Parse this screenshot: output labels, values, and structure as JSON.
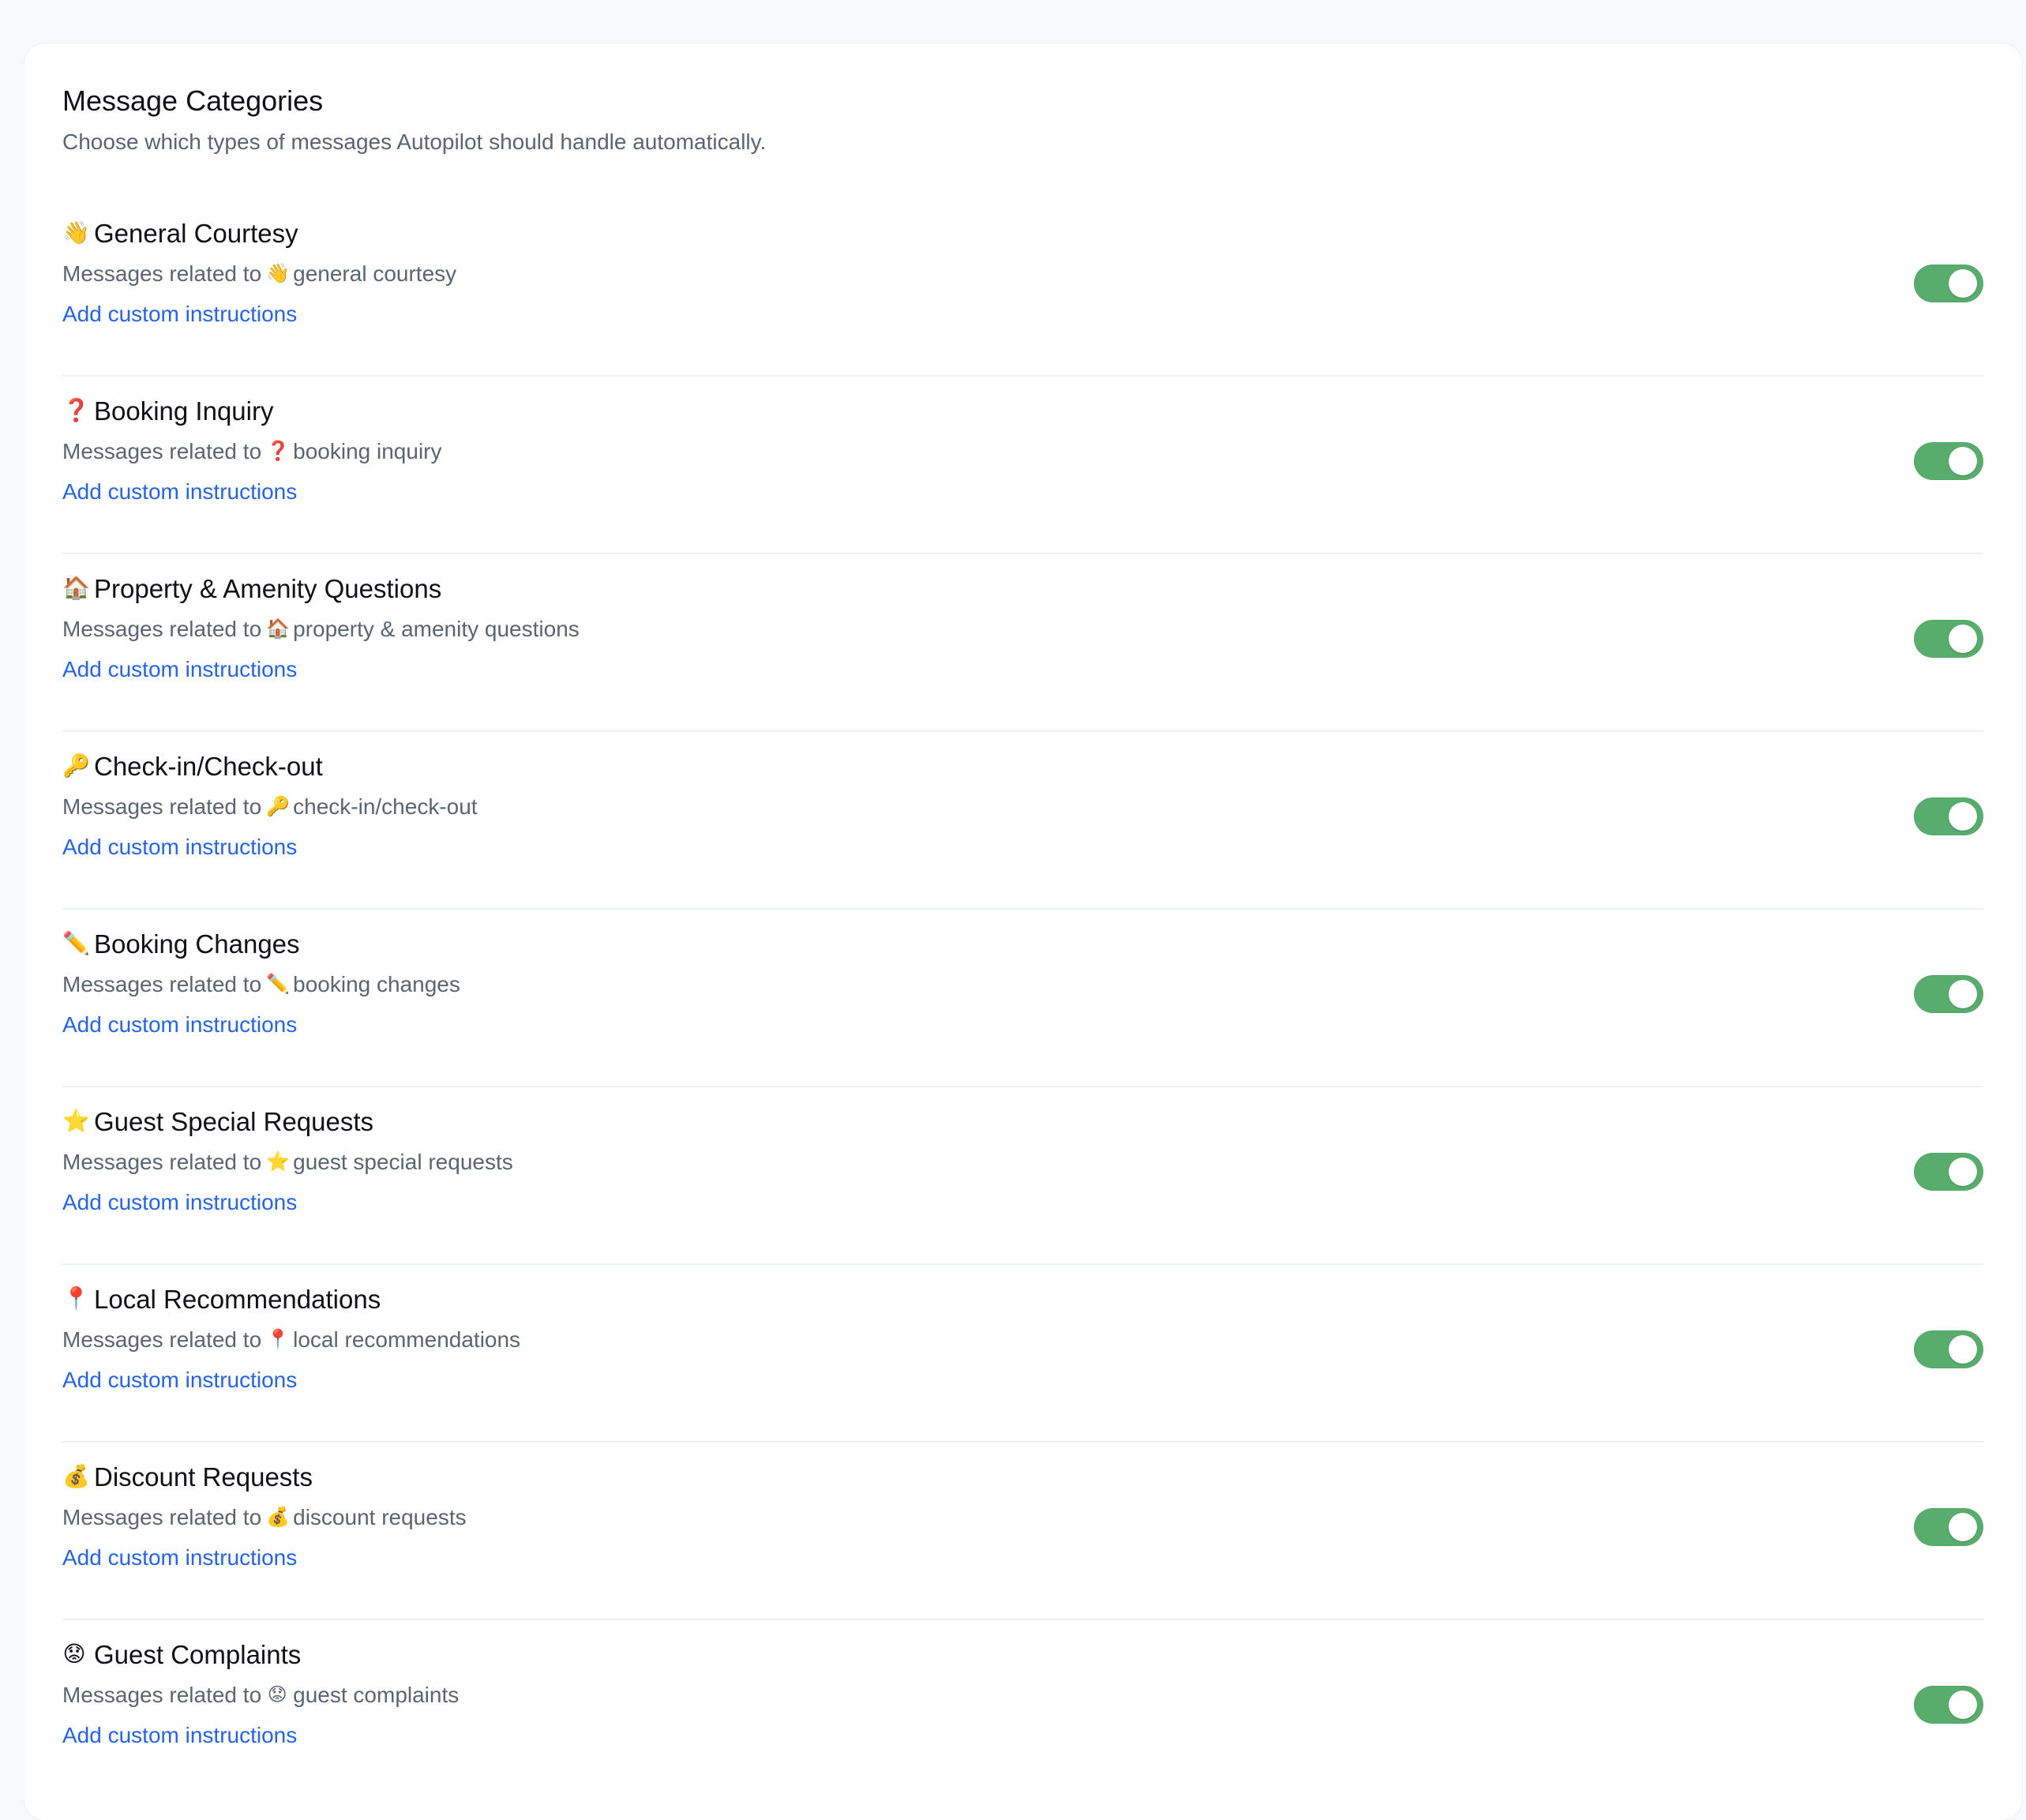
{
  "panel": {
    "title": "Message Categories",
    "subtitle": "Choose which types of messages Autopilot should handle automatically."
  },
  "categories": [
    {
      "emoji": "👋",
      "title": "General Courtesy",
      "description_prefix": "Messages related to",
      "description_emoji": "👋",
      "description_text": "general courtesy",
      "action_label": "Add custom instructions",
      "enabled": true
    },
    {
      "emoji": "❓",
      "title": "Booking Inquiry",
      "description_prefix": "Messages related to",
      "description_emoji": "❓",
      "description_text": "booking inquiry",
      "action_label": "Add custom instructions",
      "enabled": true
    },
    {
      "emoji": "🏠",
      "title": "Property & Amenity Questions",
      "description_prefix": "Messages related to",
      "description_emoji": "🏠",
      "description_text": "property & amenity questions",
      "action_label": "Add custom instructions",
      "enabled": true
    },
    {
      "emoji": "🔑",
      "title": "Check-in/Check-out",
      "description_prefix": "Messages related to",
      "description_emoji": "🔑",
      "description_text": "check-in/check-out",
      "action_label": "Add custom instructions",
      "enabled": true
    },
    {
      "emoji": "✏️",
      "title": "Booking Changes",
      "description_prefix": "Messages related to",
      "description_emoji": "✏️",
      "description_text": "booking changes",
      "action_label": "Add custom instructions",
      "enabled": true
    },
    {
      "emoji": "⭐",
      "title": "Guest Special Requests",
      "description_prefix": "Messages related to",
      "description_emoji": "⭐",
      "description_text": "guest special requests",
      "action_label": "Add custom instructions",
      "enabled": true
    },
    {
      "emoji": "📍",
      "title": "Local Recommendations",
      "description_prefix": "Messages related to",
      "description_emoji": "📍",
      "description_text": "local recommendations",
      "action_label": "Add custom instructions",
      "enabled": true
    },
    {
      "emoji": "💰",
      "title": "Discount Requests",
      "description_prefix": "Messages related to",
      "description_emoji": "💰",
      "description_text": "discount requests",
      "action_label": "Add custom instructions",
      "enabled": true
    },
    {
      "emoji": "😟",
      "title": "Guest Complaints",
      "description_prefix": "Messages related to",
      "description_emoji": "😟",
      "description_text": "guest complaints",
      "action_label": "Add custom instructions",
      "enabled": true
    }
  ],
  "colors": {
    "toggle_on": "#58ad6d",
    "link": "#2563eb",
    "muted_text": "#5b6472",
    "divider": "#edf0f3",
    "page_background": "#f8f9fb"
  }
}
